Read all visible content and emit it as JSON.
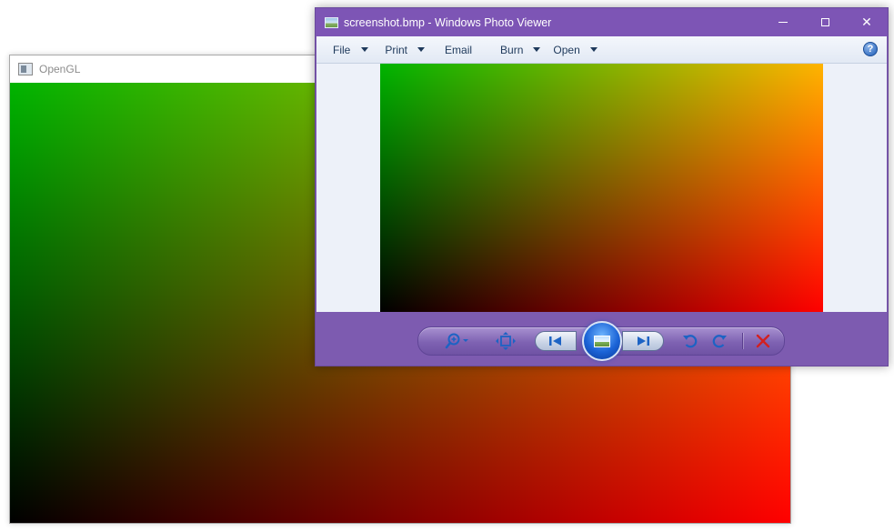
{
  "opengl_window": {
    "title": "OpenGL"
  },
  "photo_viewer": {
    "title": "screenshot.bmp - Windows Photo Viewer",
    "menu": [
      {
        "label": "File",
        "has_dropdown": true
      },
      {
        "label": "Print",
        "has_dropdown": true
      },
      {
        "label": "Email",
        "has_dropdown": false
      },
      {
        "label": "Burn",
        "has_dropdown": true
      },
      {
        "label": "Open",
        "has_dropdown": true
      }
    ],
    "help_glyph": "?",
    "close_glyph": "✕",
    "toolbar": {
      "icons": [
        "zoom-icon",
        "fit-window-icon",
        "previous-icon",
        "slideshow-icon",
        "next-icon",
        "rotate-counterclockwise-icon",
        "rotate-clockwise-icon",
        "delete-icon"
      ]
    },
    "colors": {
      "titlebar": "#7d55b5",
      "frame": "#7d5bb0",
      "menubar": "#e2e9f4",
      "content_bg": "#edf1f9",
      "menu_text": "#1e395b",
      "delete_icon": "#d32020"
    }
  }
}
